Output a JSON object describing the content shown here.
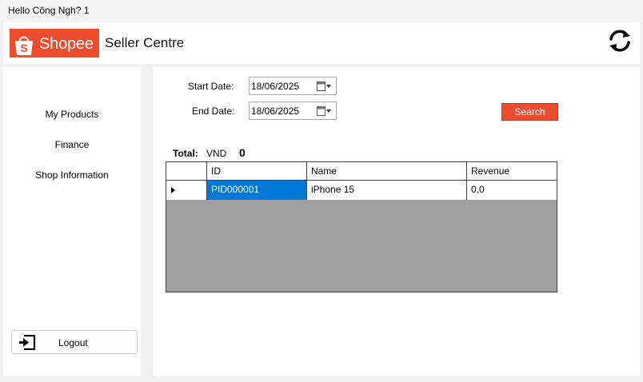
{
  "window": {
    "title": "Hello Công Ngh? 1"
  },
  "header": {
    "brand": "Shopee",
    "bag_letter": "S",
    "centre_label": "Seller Centre",
    "brand_color": "#ee4d2d"
  },
  "sidebar": {
    "items": [
      {
        "label": "My Products"
      },
      {
        "label": "Finance"
      },
      {
        "label": "Shop Information"
      }
    ],
    "logout_label": "Logout"
  },
  "filters": {
    "start_label": "Start Date:",
    "start_value": "18/06/2025",
    "end_label": "End Date:",
    "end_value": "18/06/2025",
    "search_label": "Search"
  },
  "total": {
    "label": "Total:",
    "currency": "VND",
    "value": "0"
  },
  "grid": {
    "columns": [
      "ID",
      "Name",
      "Revenue"
    ],
    "rows": [
      {
        "id": "PID000001",
        "name": "iPhone 15",
        "revenue": "0,0"
      }
    ]
  }
}
